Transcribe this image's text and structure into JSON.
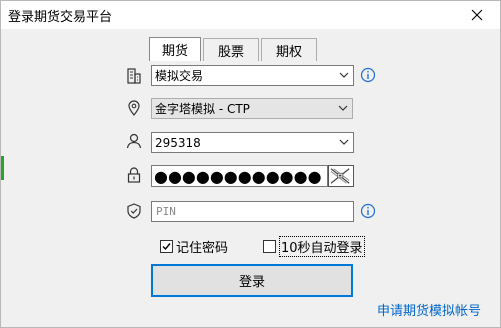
{
  "window": {
    "title": "登录期货交易平台"
  },
  "tabs": [
    {
      "label": "期货",
      "active": true
    },
    {
      "label": "股票",
      "active": false
    },
    {
      "label": "期权",
      "active": false
    }
  ],
  "form": {
    "trading_mode": "模拟交易",
    "server": "金字塔模拟 - CTP",
    "account": "295318",
    "password_mask": "●●●●●●●●●●●●",
    "pin_placeholder": "PIN",
    "remember_password_label": "记住密码",
    "remember_password_checked": true,
    "auto_login_label": "10秒自动登录",
    "auto_login_checked": false,
    "login_label": "登录",
    "apply_link": "申请期货模拟帐号"
  },
  "colors": {
    "accent": "#0078d7",
    "link": "#0066cc",
    "info": "#1e6fd0"
  },
  "icons": [
    "building-icon",
    "location-pin-icon",
    "user-icon",
    "lock-icon",
    "shield-icon",
    "info-icon",
    "keyboard-icon",
    "close-icon",
    "chevron-down-icon"
  ]
}
